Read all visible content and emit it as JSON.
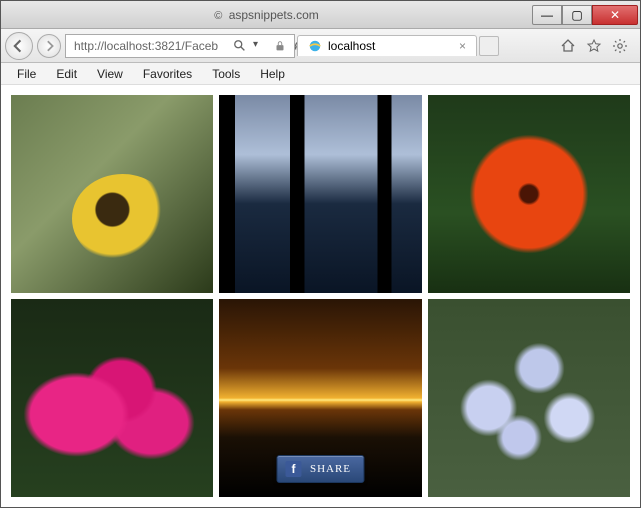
{
  "titlebar": {
    "site": "aspsnippets.com"
  },
  "window_controls": {
    "min": "—",
    "max": "▢",
    "close": "✕"
  },
  "nav": {
    "url": "http://localhost:3821/Faceb",
    "search_placeholder": "",
    "tab_title": "localhost",
    "tab_close": "×"
  },
  "menu": {
    "items": [
      "File",
      "Edit",
      "View",
      "Favorites",
      "Tools",
      "Help"
    ]
  },
  "gallery": {
    "images": [
      {
        "name": "pansy-flower"
      },
      {
        "name": "lake-dusk"
      },
      {
        "name": "orange-gerbera"
      },
      {
        "name": "pink-celosia"
      },
      {
        "name": "sunset"
      },
      {
        "name": "blue-columbine"
      }
    ]
  },
  "share": {
    "badge": "f",
    "label": "SHARE"
  }
}
